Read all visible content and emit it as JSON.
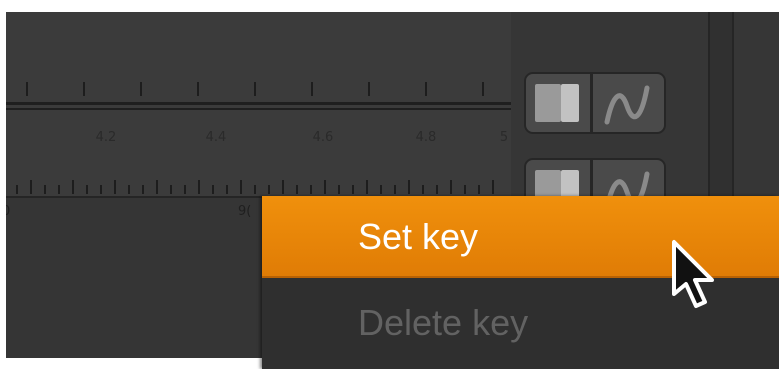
{
  "timeline": {
    "ruler_labels": [
      "4.2",
      "4.4",
      "4.6",
      "4.8",
      "5"
    ],
    "track_labels": [
      "0",
      "9("
    ]
  },
  "curve_toggles": [
    {
      "icon": "split-box-icon"
    },
    {
      "icon": "curve-icon"
    }
  ],
  "context_menu": {
    "items": [
      {
        "label": "Set key",
        "state": "highlighted"
      },
      {
        "label": "Delete key",
        "state": "disabled"
      }
    ]
  },
  "colors": {
    "accent": "#f0900c",
    "panel": "#363636",
    "disabled_text": "#626262"
  }
}
